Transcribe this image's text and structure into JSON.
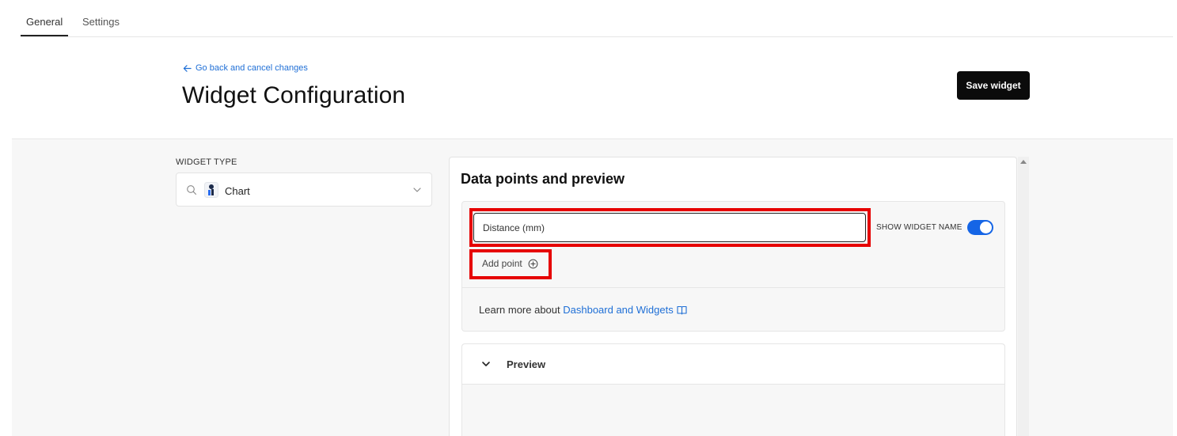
{
  "tabs": [
    {
      "label": "General",
      "active": true
    },
    {
      "label": "Settings",
      "active": false
    }
  ],
  "header": {
    "back_link": "Go back and cancel changes",
    "title": "Widget Configuration",
    "save_label": "Save widget"
  },
  "widget_type": {
    "label": "WIDGET TYPE",
    "value": "Chart"
  },
  "panel": {
    "title": "Data points and preview",
    "data_point_value": "Distance (mm)",
    "data_point_placeholder": "Distance (mm)",
    "show_widget_name_label": "SHOW WIDGET NAME",
    "show_widget_name_on": true,
    "add_point_label": "Add point",
    "learn_more_prefix": "Learn more about ",
    "learn_more_link": "Dashboard and Widgets",
    "preview_label": "Preview"
  },
  "colors": {
    "accent": "#1f6fd6",
    "toggle": "#1565e6",
    "highlight": "#e60000",
    "button": "#0b0b0b"
  },
  "icons": [
    "arrow-left-icon",
    "search-icon",
    "chart-type-icon",
    "chevron-down-icon",
    "plus-circle-icon",
    "book-icon"
  ]
}
